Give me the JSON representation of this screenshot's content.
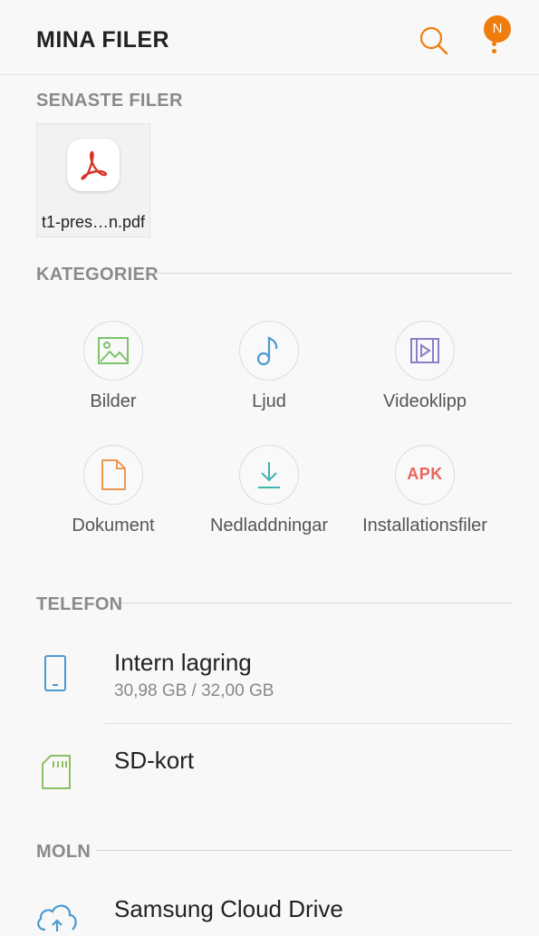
{
  "header": {
    "title": "MINA FILER",
    "notification_badge": "N"
  },
  "recent": {
    "label": "SENASTE FILER",
    "files": [
      {
        "name": "t1-pres…n.pdf",
        "icon": "pdf-icon"
      }
    ]
  },
  "categories": {
    "label": "KATEGORIER",
    "items": [
      {
        "label": "Bilder",
        "icon": "image-icon",
        "color": "#7cc36b"
      },
      {
        "label": "Ljud",
        "icon": "music-note-icon",
        "color": "#4a9ad0"
      },
      {
        "label": "Videoklipp",
        "icon": "video-icon",
        "color": "#8b7ec9"
      },
      {
        "label": "Dokument",
        "icon": "document-icon",
        "color": "#e99a52"
      },
      {
        "label": "Nedladdningar",
        "icon": "download-icon",
        "color": "#3fb3b0"
      },
      {
        "label": "Installationsfiler",
        "icon_text": "APK",
        "color": "#e8655c"
      }
    ]
  },
  "phone": {
    "label": "TELEFON",
    "items": [
      {
        "name": "Intern lagring",
        "detail": "30,98 GB / 32,00 GB",
        "icon": "phone-icon"
      },
      {
        "name": "SD-kort",
        "icon": "sd-card-icon"
      }
    ]
  },
  "cloud": {
    "label": "MOLN",
    "items": [
      {
        "name": "Samsung Cloud Drive",
        "icon": "cloud-icon"
      }
    ]
  },
  "colors": {
    "accent": "#ef7d0e",
    "section_label": "#8a8a8a"
  }
}
